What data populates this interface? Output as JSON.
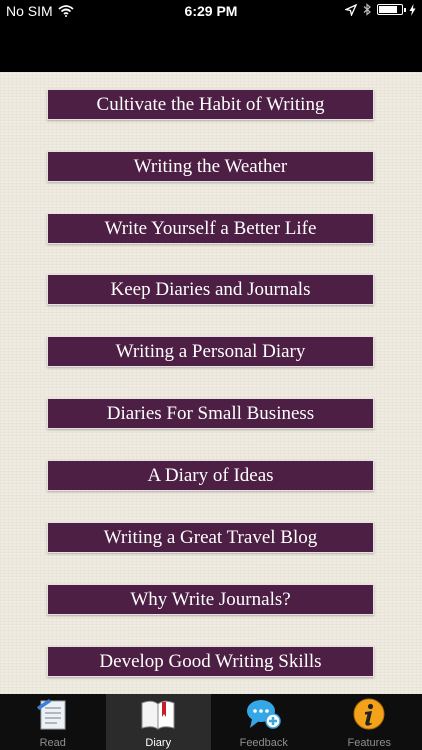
{
  "status_bar": {
    "carrier": "No SIM",
    "time": "6:29 PM",
    "battery_level": 0.85
  },
  "menu": {
    "items": [
      {
        "label": "Cultivate the Habit of Writing"
      },
      {
        "label": "Writing the Weather"
      },
      {
        "label": "Write Yourself a Better Life"
      },
      {
        "label": "Keep Diaries and Journals"
      },
      {
        "label": "Writing a Personal Diary"
      },
      {
        "label": "Diaries For Small Business"
      },
      {
        "label": "A Diary of Ideas"
      },
      {
        "label": "Writing a Great Travel Blog"
      },
      {
        "label": "Why Write Journals?"
      },
      {
        "label": "Develop Good Writing Skills"
      }
    ],
    "button_color": "#4d1f44"
  },
  "tab_bar": {
    "tabs": [
      {
        "label": "Read",
        "icon": "document-icon"
      },
      {
        "label": "Diary",
        "icon": "book-icon",
        "selected": true
      },
      {
        "label": "Feedback",
        "icon": "speech-bubble-plus-icon"
      },
      {
        "label": "Features",
        "icon": "info-icon"
      }
    ]
  }
}
